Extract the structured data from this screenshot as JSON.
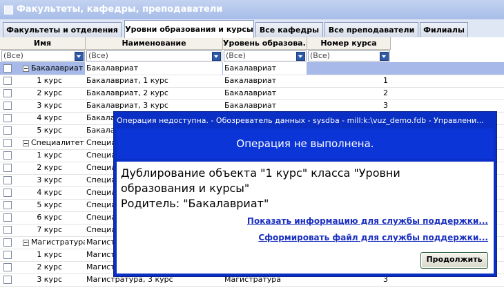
{
  "window": {
    "title": "Факультеты, кафедры, преподаватели"
  },
  "tabs": [
    {
      "label": "Факультеты и отделения",
      "active": false
    },
    {
      "label": "Уровни образования и курсы",
      "active": true
    },
    {
      "label": "Все кафедры",
      "active": false
    },
    {
      "label": "Все преподаватели",
      "active": false
    },
    {
      "label": "Филиалы",
      "active": false
    }
  ],
  "grid": {
    "columns": [
      "Имя",
      "Наименование",
      "Уровень образова...",
      "Номер курса"
    ],
    "filters": [
      "(Все)",
      "(Все)",
      "(Все)",
      "(Все)"
    ],
    "rows": [
      {
        "name": "Бакалавриат",
        "title": "Бакалавриат",
        "level": "Бакалавриат",
        "num": "",
        "group": true,
        "selected": true
      },
      {
        "name": "1 курс",
        "title": "Бакалавриат, 1 курс",
        "level": "Бакалавриат",
        "num": "1"
      },
      {
        "name": "2 курс",
        "title": "Бакалавриат, 2 курс",
        "level": "Бакалавриат",
        "num": "2"
      },
      {
        "name": "3 курс",
        "title": "Бакалавриат, 3 курс",
        "level": "Бакалавриат",
        "num": "3"
      },
      {
        "name": "4 курс",
        "title": "Бакала",
        "level": "",
        "num": ""
      },
      {
        "name": "5 курс",
        "title": "Бакала",
        "level": "",
        "num": ""
      },
      {
        "name": "Специалитет",
        "title": "Специа",
        "level": "",
        "num": "",
        "group": true
      },
      {
        "name": "1 курс",
        "title": "Специа",
        "level": "",
        "num": ""
      },
      {
        "name": "2 курс",
        "title": "Специа",
        "level": "",
        "num": ""
      },
      {
        "name": "3 курс",
        "title": "Специа",
        "level": "",
        "num": ""
      },
      {
        "name": "4 курс",
        "title": "Специа",
        "level": "",
        "num": ""
      },
      {
        "name": "5 курс",
        "title": "Специа",
        "level": "",
        "num": ""
      },
      {
        "name": "6 курс",
        "title": "Специа",
        "level": "",
        "num": ""
      },
      {
        "name": "7 курс",
        "title": "Специа",
        "level": "",
        "num": ""
      },
      {
        "name": "Магистратура",
        "title": "Магистр",
        "level": "",
        "num": "",
        "group": true
      },
      {
        "name": "1 курс",
        "title": "Магистр",
        "level": "",
        "num": ""
      },
      {
        "name": "2 курс",
        "title": "Магистр",
        "level": "",
        "num": ""
      },
      {
        "name": "3 курс",
        "title": "Магистратура, 3 курс",
        "level": "Магистратура",
        "num": "3"
      }
    ]
  },
  "dialog": {
    "title": "Операция недоступна. - Обозреватель данных - sysdba - mill:k:\\vuz_demo.fdb - Управлени...",
    "heading": "Операция не выполнена.",
    "message_lines": [
      "Дублирование объекта \"1 курс\" класса \"Уровни",
      "образования и курсы\"",
      "Родитель: \"Бакалавриат\""
    ],
    "link_support_info": "Показать информацию для службы поддержки...",
    "link_support_file": "Сформировать файл для службы поддержки...",
    "continue_label": "Продолжить"
  },
  "colors": {
    "dialog_blue": "#0a2fc4",
    "selection": "#a6b9e8",
    "link": "#1a2fc0"
  }
}
